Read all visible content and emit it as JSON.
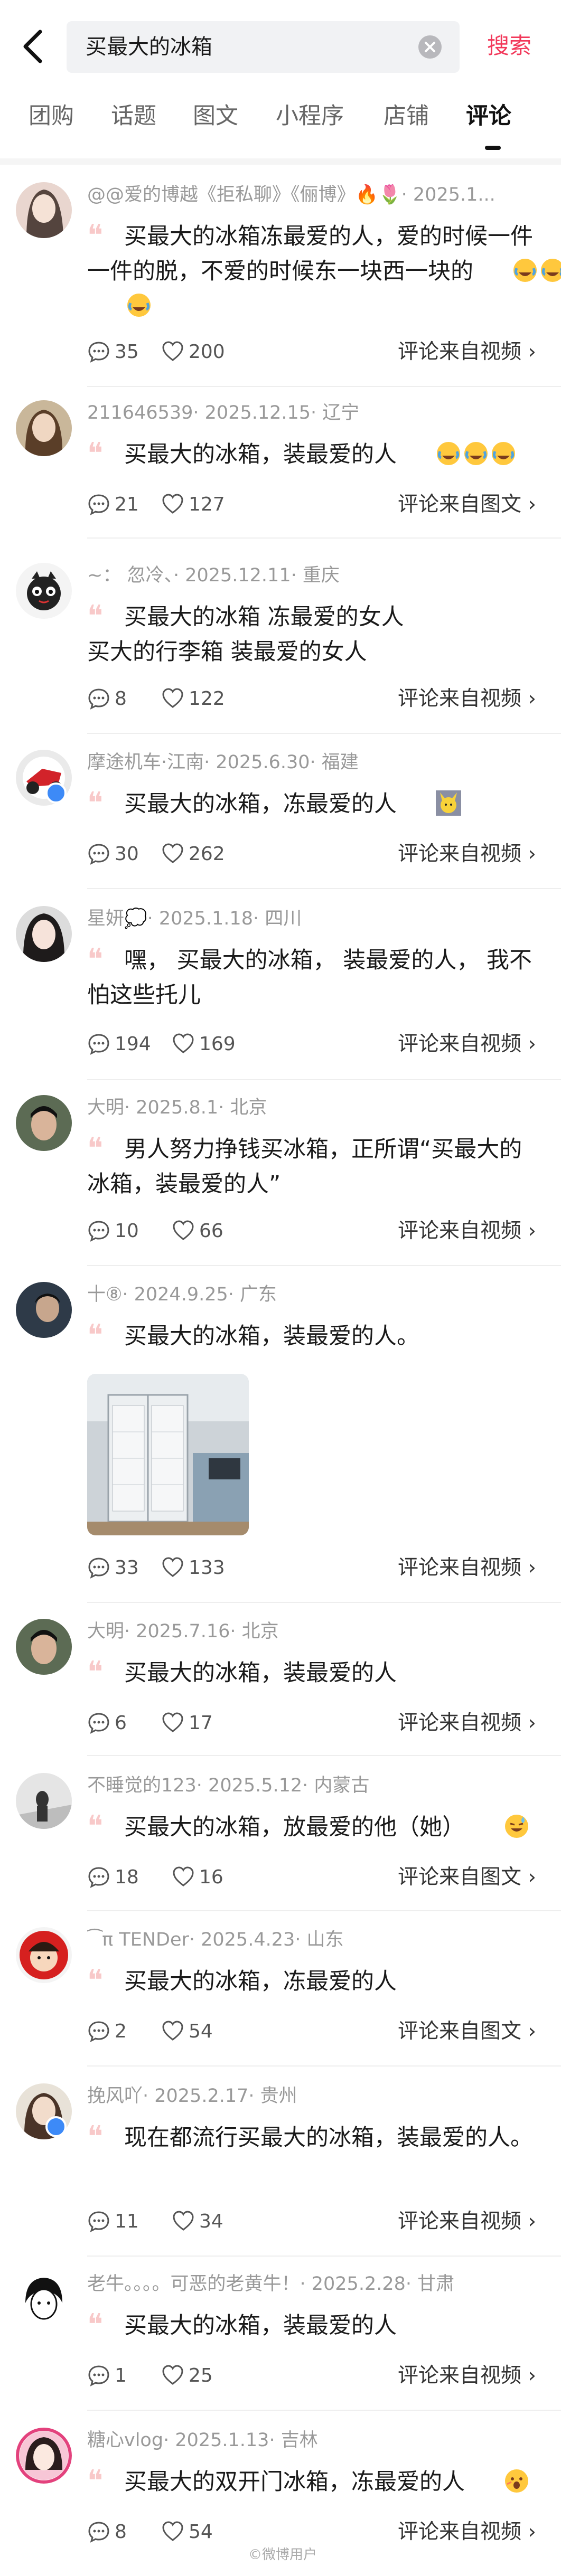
{
  "search": {
    "query": "买最大的冰箱",
    "button": "搜索"
  },
  "tabs": [
    "团购",
    "话题",
    "图文",
    "小程序",
    "店铺",
    "评论"
  ],
  "comments": [
    {
      "meta": "@@爱的博越《拒私聊》《俪博》🔥🌷· 2025.1...",
      "text": "买最大的冰箱冻最爱的人，爱的时候一件一件的脱，不爱的时候东一块西一块的",
      "likes_comments": "35",
      "likes": "200",
      "source": "评论来自视频 ›"
    },
    {
      "meta": "211646539· 2025.12.15· 辽宁",
      "text": "买最大的冰箱，装最爱的人",
      "likes_comments": "21",
      "likes": "127",
      "source": "评论来自图文 ›"
    },
    {
      "meta": "~： 忽冷、· 2025.12.11· 重庆",
      "text": "买最大的冰箱 冻最爱的女人\n买大的行李箱 装最爱的女人",
      "likes_comments": "8",
      "likes": "122",
      "source": "评论来自视频 ›"
    },
    {
      "meta": "摩途机车·江南· 2025.6.30· 福建",
      "text": "买最大的冰箱，冻最爱的人",
      "likes_comments": "30",
      "likes": "262",
      "source": "评论来自视频 ›"
    },
    {
      "meta": "星妍💭· 2025.1.18· 四川",
      "text": "嘿， 买最大的冰箱， 装最爱的人， 我不怕这些托儿",
      "likes_comments": "194",
      "likes": "169",
      "source": "评论来自视频 ›"
    },
    {
      "meta": "大明· 2025.8.1· 北京",
      "text": "男人努力挣钱买冰箱，正所谓“买最大的冰箱，装最爱的人”",
      "likes_comments": "10",
      "likes": "66",
      "source": "评论来自视频 ›"
    },
    {
      "meta": "十⑧· 2024.9.25· 广东",
      "text": "买最大的冰箱，装最爱的人。",
      "likes_comments": "33",
      "likes": "133",
      "source": "评论来自视频 ›"
    },
    {
      "meta": "大明· 2025.7.16· 北京",
      "text": "买最大的冰箱，装最爱的人",
      "likes_comments": "6",
      "likes": "17",
      "source": "评论来自视频 ›"
    },
    {
      "meta": "不睡觉的123· 2025.5.12· 内蒙古",
      "text": "买最大的冰箱，放最爱的他（她）",
      "likes_comments": "18",
      "likes": "16",
      "source": "评论来自图文 ›"
    },
    {
      "meta": "⁀π TENDer· 2025.4.23· 山东",
      "text": "买最大的冰箱，冻最爱的人",
      "likes_comments": "2",
      "likes": "54",
      "source": "评论来自图文 ›"
    },
    {
      "meta": "挽风吖· 2025.2.17· 贵州",
      "text": "现在都流行买最大的冰箱，装最爱的人。",
      "likes_comments": "11",
      "likes": "34",
      "source": "评论来自视频 ›"
    },
    {
      "meta": "老牛。。。。可恶的老黄牛！· 2025.2.28· 甘肃",
      "text": "买最大的冰箱，装最爱的人",
      "likes_comments": "1",
      "likes": "25",
      "source": "评论来自视频 ›"
    },
    {
      "meta": "糖心vlog· 2025.1.13· 吉林",
      "text": "买最大的双开门冰箱，冻最爱的人",
      "likes_comments": "8",
      "likes": "54",
      "source": "评论来自视频 ›"
    }
  ],
  "watermark": "©微博用户",
  "colors": {
    "accent": "#f2385a",
    "meta": "#999999",
    "quote": "#f8c9c9"
  }
}
